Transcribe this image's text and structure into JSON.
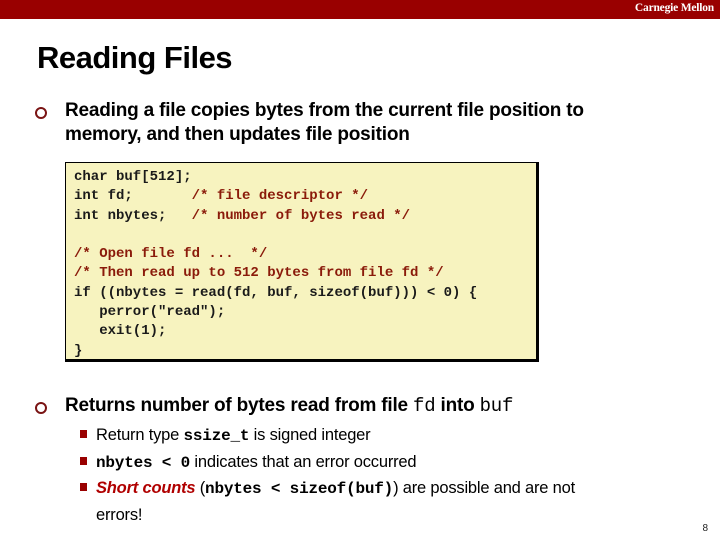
{
  "header": {
    "brand": "Carnegie Mellon",
    "bar_color": "#990000"
  },
  "slide": {
    "title": "Reading Files",
    "page_number": "8",
    "bullets": [
      {
        "icon": "hollow-circle-bullet",
        "text": "Reading a file copies bytes from the current file position to memory, and then updates file position"
      },
      {
        "icon": "hollow-circle-bullet",
        "text_parts": [
          "Returns number of bytes read from file ",
          "fd",
          " into ",
          "buf"
        ],
        "subbullets": [
          {
            "icon": "square-bullet",
            "parts": [
              "Return type ",
              "ssize_t",
              " is signed integer"
            ]
          },
          {
            "icon": "square-bullet",
            "parts": [
              "nbytes < 0",
              " indicates that an error occurred"
            ]
          },
          {
            "icon": "square-bullet",
            "parts": [
              "Short counts",
              " (",
              "nbytes < sizeof(buf)",
              ") are possible and are not",
              "errors!"
            ]
          }
        ]
      }
    ]
  },
  "code": {
    "background": "#f7f3bf",
    "comment_color": "#8a1a0a",
    "lines": [
      {
        "code": "char buf[512];",
        "comment": ""
      },
      {
        "code": "int fd;       ",
        "comment": "/* file descriptor */"
      },
      {
        "code": "int nbytes;   ",
        "comment": "/* number of bytes read */"
      },
      {
        "code": "",
        "comment": ""
      },
      {
        "code": "",
        "comment": "/* Open file fd ...  */"
      },
      {
        "code": "",
        "comment": "/* Then read up to 512 bytes from file fd */"
      },
      {
        "code": "if ((nbytes = read(fd, buf, sizeof(buf))) < 0) {",
        "comment": ""
      },
      {
        "code": "   perror(\"read\");",
        "comment": ""
      },
      {
        "code": "   exit(1);",
        "comment": ""
      },
      {
        "code": "}",
        "comment": ""
      }
    ]
  }
}
